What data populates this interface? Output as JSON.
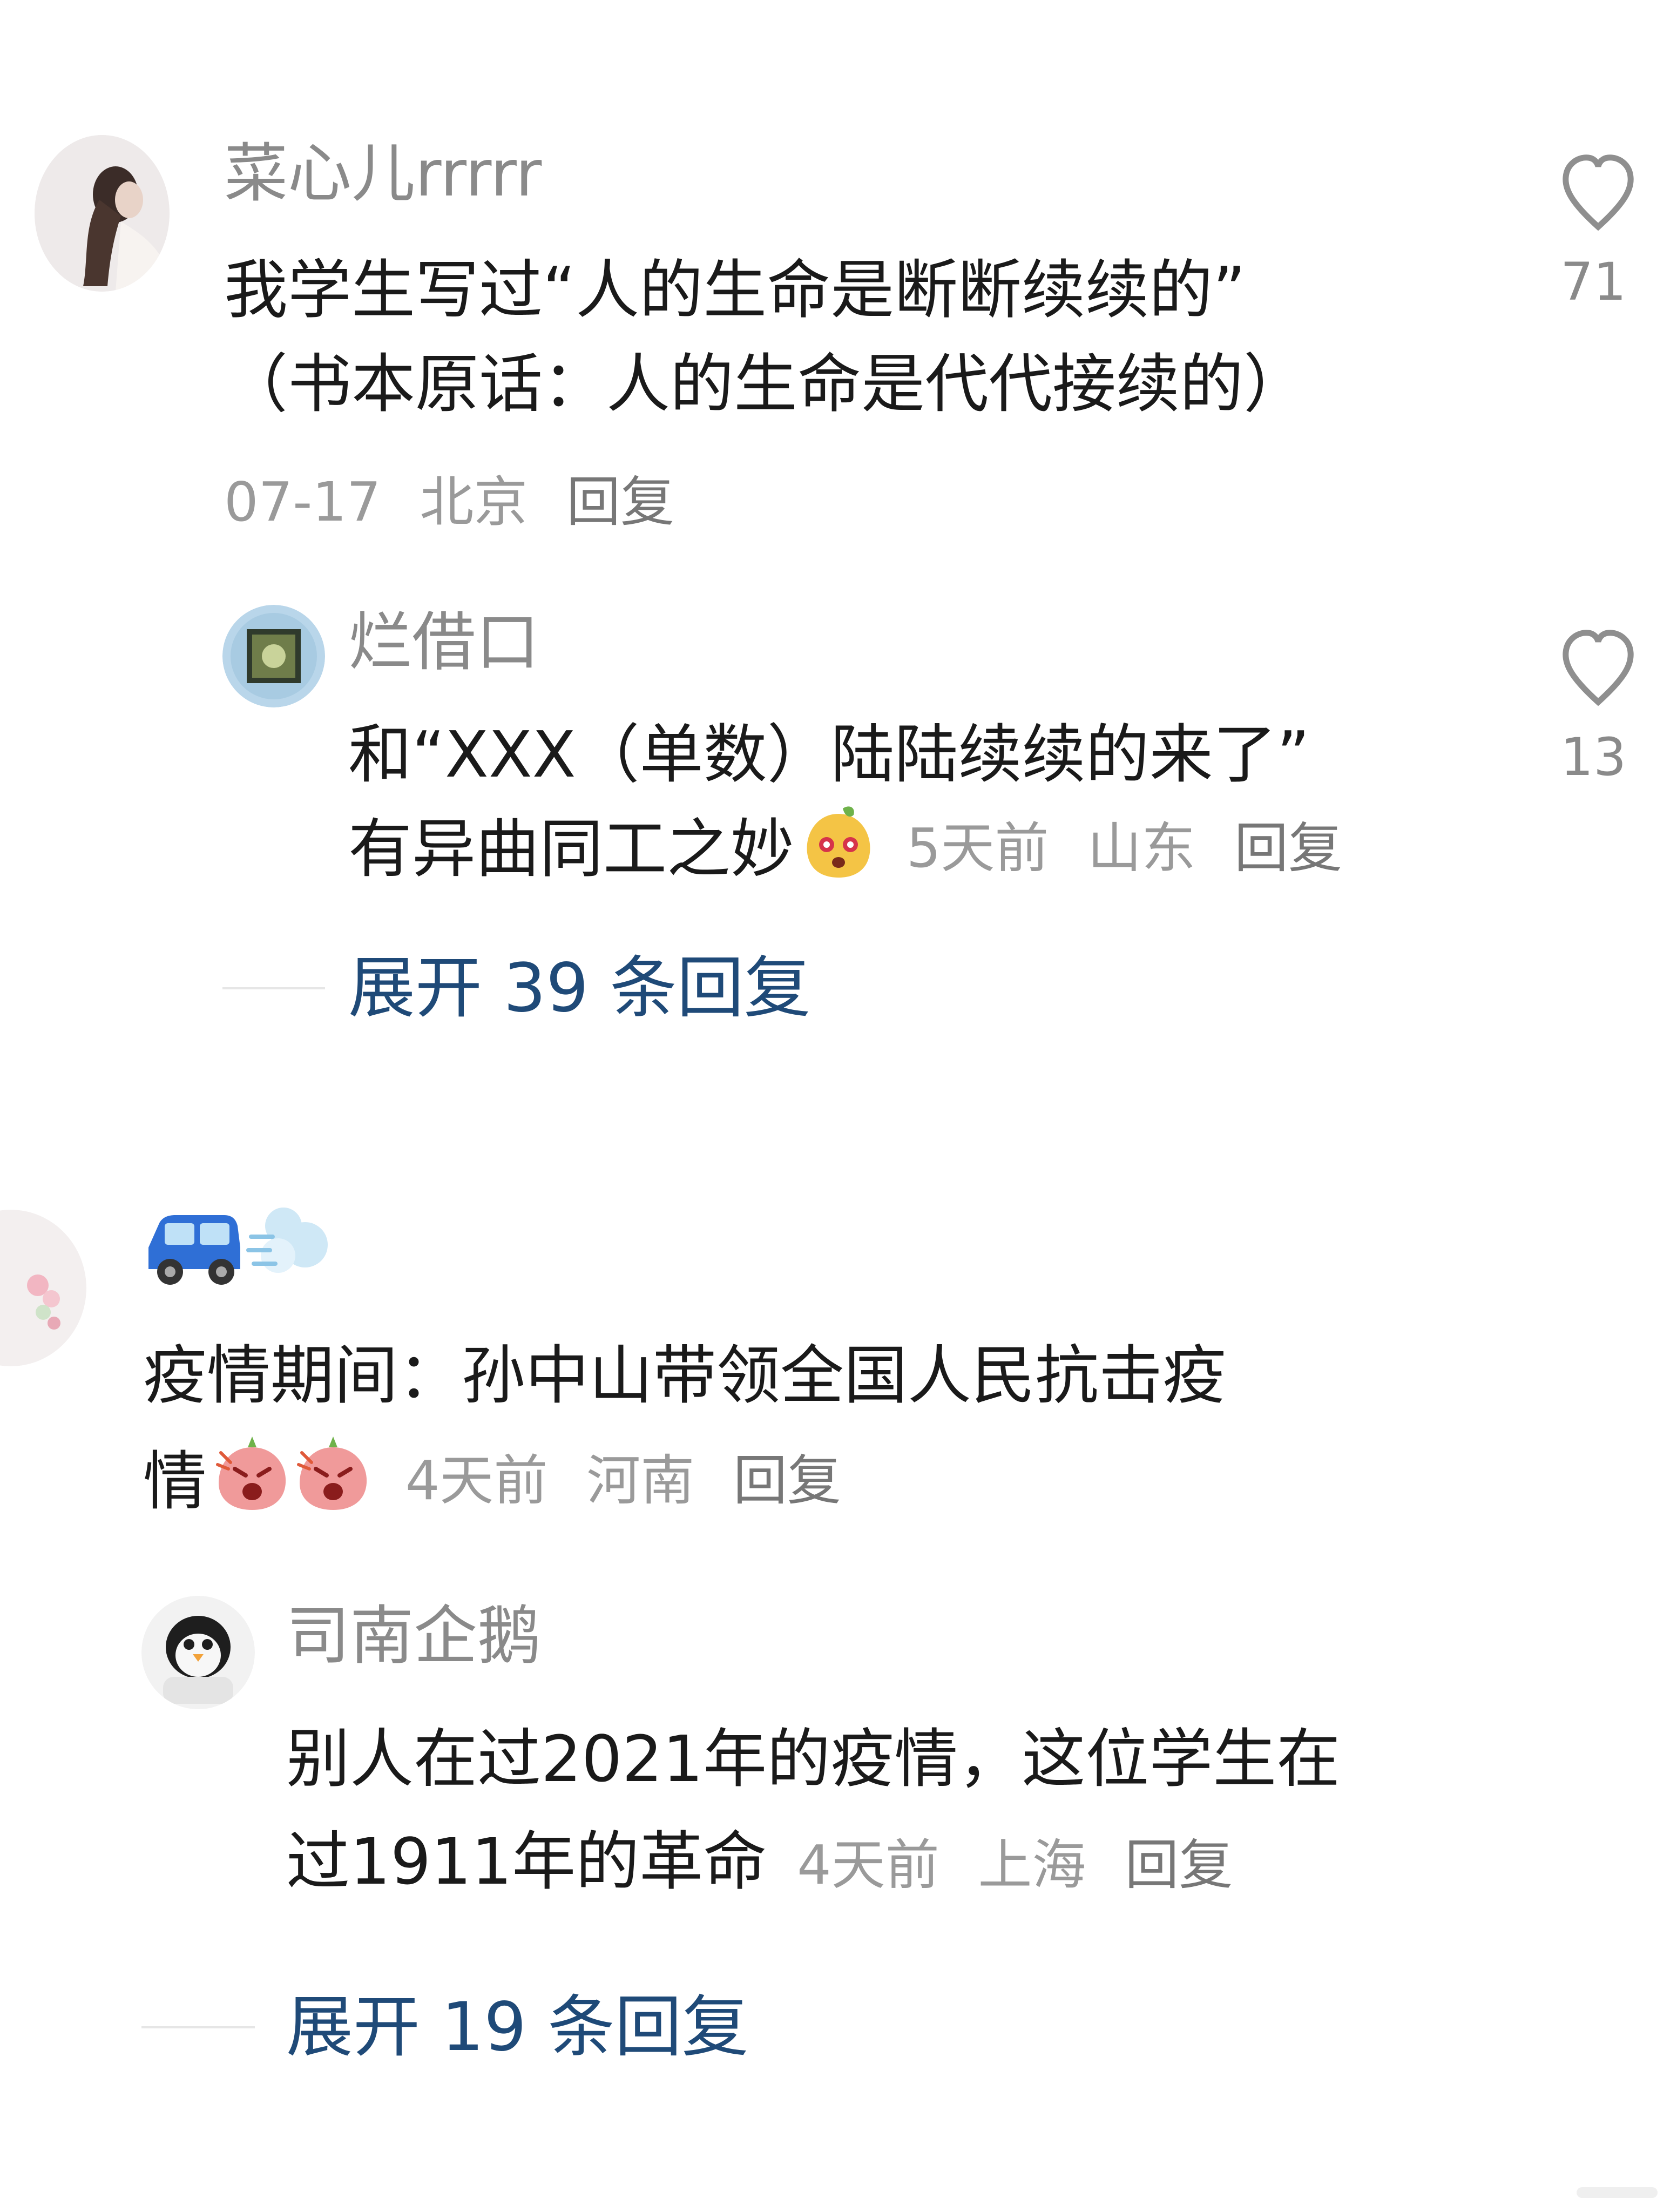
{
  "comments": [
    {
      "username": "菜心儿rrrrr",
      "content_lines": [
        "我学生写过“人的生命是断断续续的”",
        "（书本原话：人的生命是代代接续的）"
      ],
      "time": "07-17",
      "location": "北京",
      "reply_label": "回复",
      "like_count": "71",
      "replies": [
        {
          "username": "烂借口",
          "content_lines": [
            "和“XXX（单数）陆陆续续的来了”",
            "有异曲同工之妙"
          ],
          "time": "5天前",
          "location": "山东",
          "reply_label": "回复",
          "like_count": "13"
        }
      ],
      "expand_label": "展开 39 条回复"
    },
    {
      "username": "🚙💨",
      "content_lines": [
        "疫情期间：孙中山带领全国人民抗击疫",
        "情"
      ],
      "time": "4天前",
      "location": "河南",
      "reply_label": "回复",
      "replies": [
        {
          "username": "司南企鹅",
          "content_lines": [
            "别人在过2021年的疫情，这位学生在",
            "过1911年的革命"
          ],
          "time": "4天前",
          "location": "上海",
          "reply_label": "回复"
        }
      ],
      "expand_label": "展开 19 条回复"
    }
  ],
  "colors": {
    "link": "#1f4a78",
    "muted": "#9a9a9a",
    "text": "#1a1a1a"
  },
  "icons": [
    "heart-outline-icon",
    "emoji-sticker-icon",
    "angry-sticker-icon"
  ]
}
